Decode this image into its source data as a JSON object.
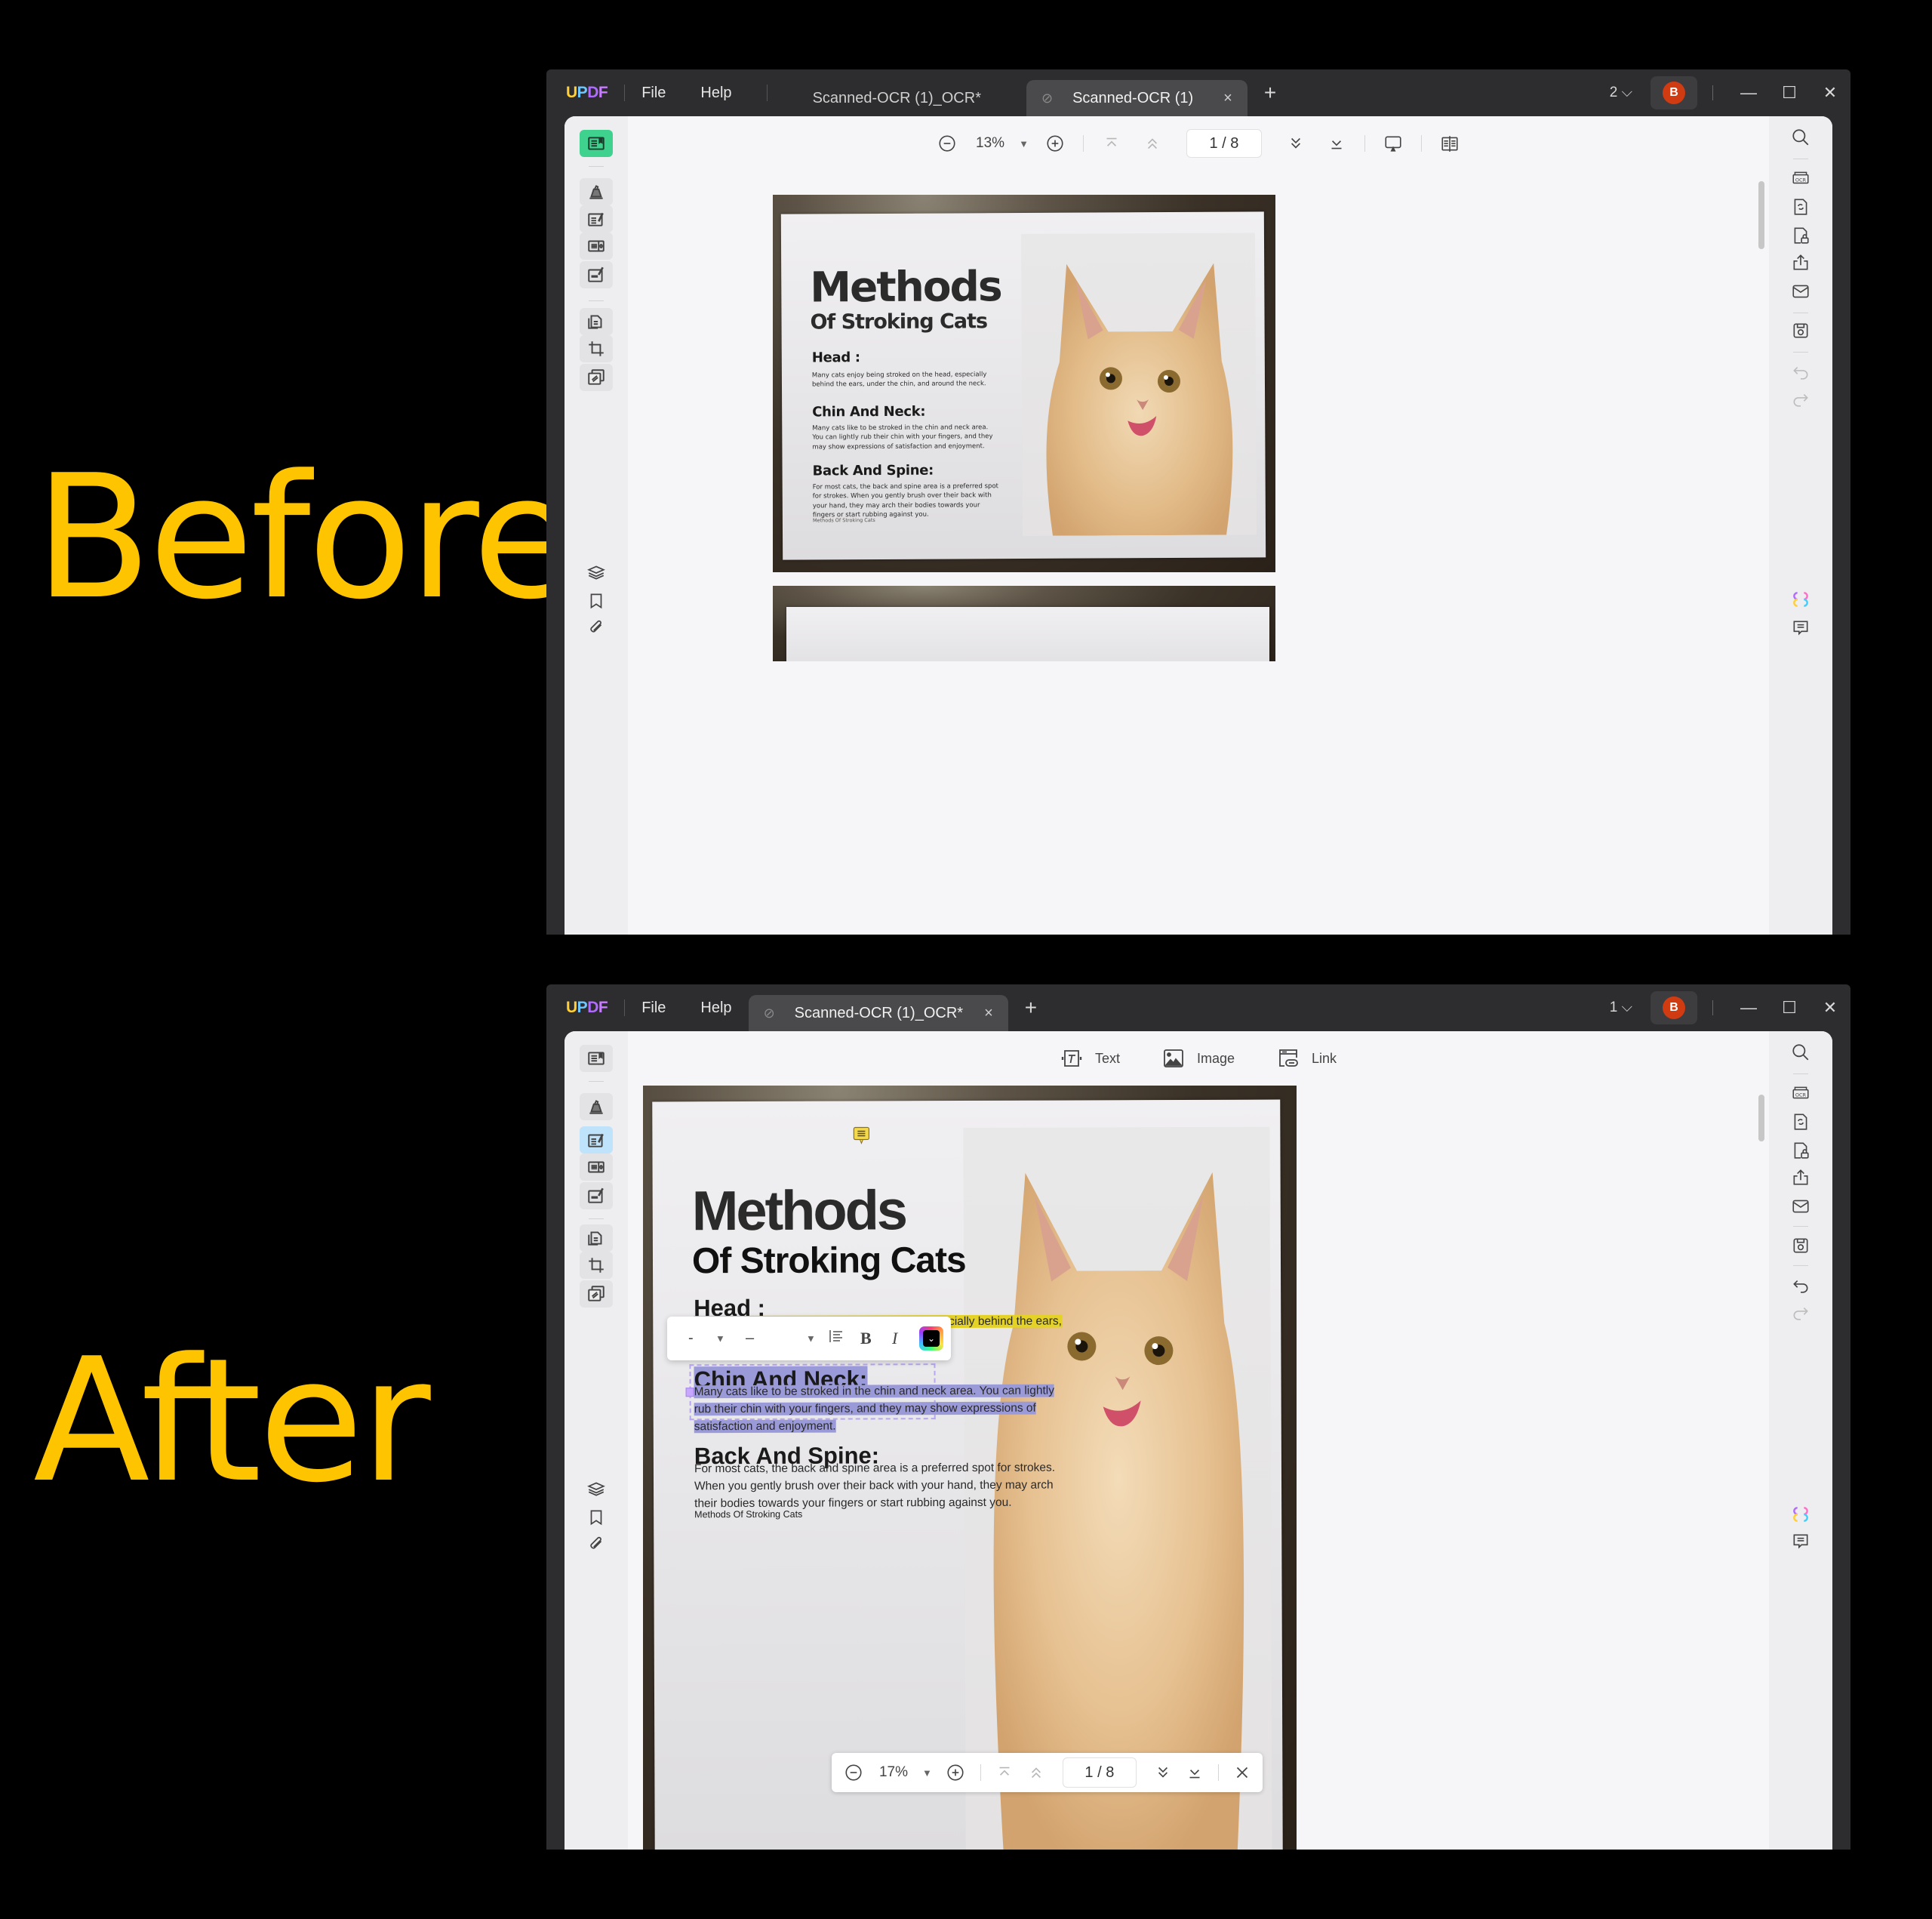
{
  "labels": {
    "before": "Before",
    "after": "After"
  },
  "app": {
    "logo_letters": [
      "U",
      "P",
      "D",
      "F"
    ],
    "menu": [
      "File",
      "Help"
    ]
  },
  "before": {
    "tabs": [
      {
        "label": "Scanned-OCR (1)_OCR*",
        "active": false
      },
      {
        "label": "Scanned-OCR (1)",
        "active": true,
        "close": "×"
      }
    ],
    "tab_add": "+",
    "window_count": "2",
    "avatar_initial": "B",
    "toolbar": {
      "zoom": "13%",
      "page": "1 / 8"
    },
    "document": {
      "title": "Methods",
      "subtitle": "Of Stroking Cats",
      "sections": [
        {
          "heading": "Head :",
          "body": "Many cats enjoy being stroked on the head, especially behind the ears, under the chin, and around the neck."
        },
        {
          "heading": "Chin And Neck:",
          "body": "Many cats like to be stroked in the chin and neck area. You can lightly rub their chin with your fingers, and they may show expressions of satisfaction and enjoyment."
        },
        {
          "heading": "Back And Spine:",
          "body": "For most cats, the back and spine area is a preferred spot for strokes. When you gently brush over their back with your hand, they may arch their bodies towards your fingers or start rubbing against you."
        }
      ],
      "footer": "Methods Of Stroking Cats"
    }
  },
  "after": {
    "tabs": [
      {
        "label": "Scanned-OCR (1)_OCR*",
        "active": true,
        "close": "×"
      }
    ],
    "tab_add": "+",
    "window_count": "1",
    "avatar_initial": "B",
    "edit_tools": [
      {
        "icon": "text-tool-icon",
        "label": "Text"
      },
      {
        "icon": "image-tool-icon",
        "label": "Image"
      },
      {
        "icon": "link-tool-icon",
        "label": "Link"
      }
    ],
    "format_bar": {
      "font": "-",
      "size": "–",
      "bold": "B",
      "italic": "I"
    },
    "floating_nav": {
      "zoom": "17%",
      "page": "1 / 8"
    },
    "document": {
      "title": "Methods",
      "subtitle": "Of Stroking Cats",
      "head": {
        "heading": "Head :",
        "line1": "Many cats enjoy being stroked on the head, especially behind the ears,"
      },
      "chin": {
        "heading": "Chin And Neck:",
        "lines": [
          "Many cats like to be stroked in the chin and neck area. You can lightly",
          "rub their chin with your fingers, and they may show expressions of",
          "satisfaction and enjoyment."
        ]
      },
      "back": {
        "heading": "Back And Spine:",
        "lines": [
          "For most cats, the back and spine area is a preferred spot for strokes.",
          "When you gently brush over their back with your hand, they may arch",
          "their bodies towards your fingers or start rubbing against you."
        ]
      },
      "footer": "Methods Of Stroking Cats"
    }
  },
  "colors": {
    "label_yellow": "#ffc400",
    "accent_green": "#3fd28f",
    "avatar_red": "#d13b12",
    "highlight_yellow": "#e4d227",
    "selection_blue": "#9b9ad8"
  }
}
